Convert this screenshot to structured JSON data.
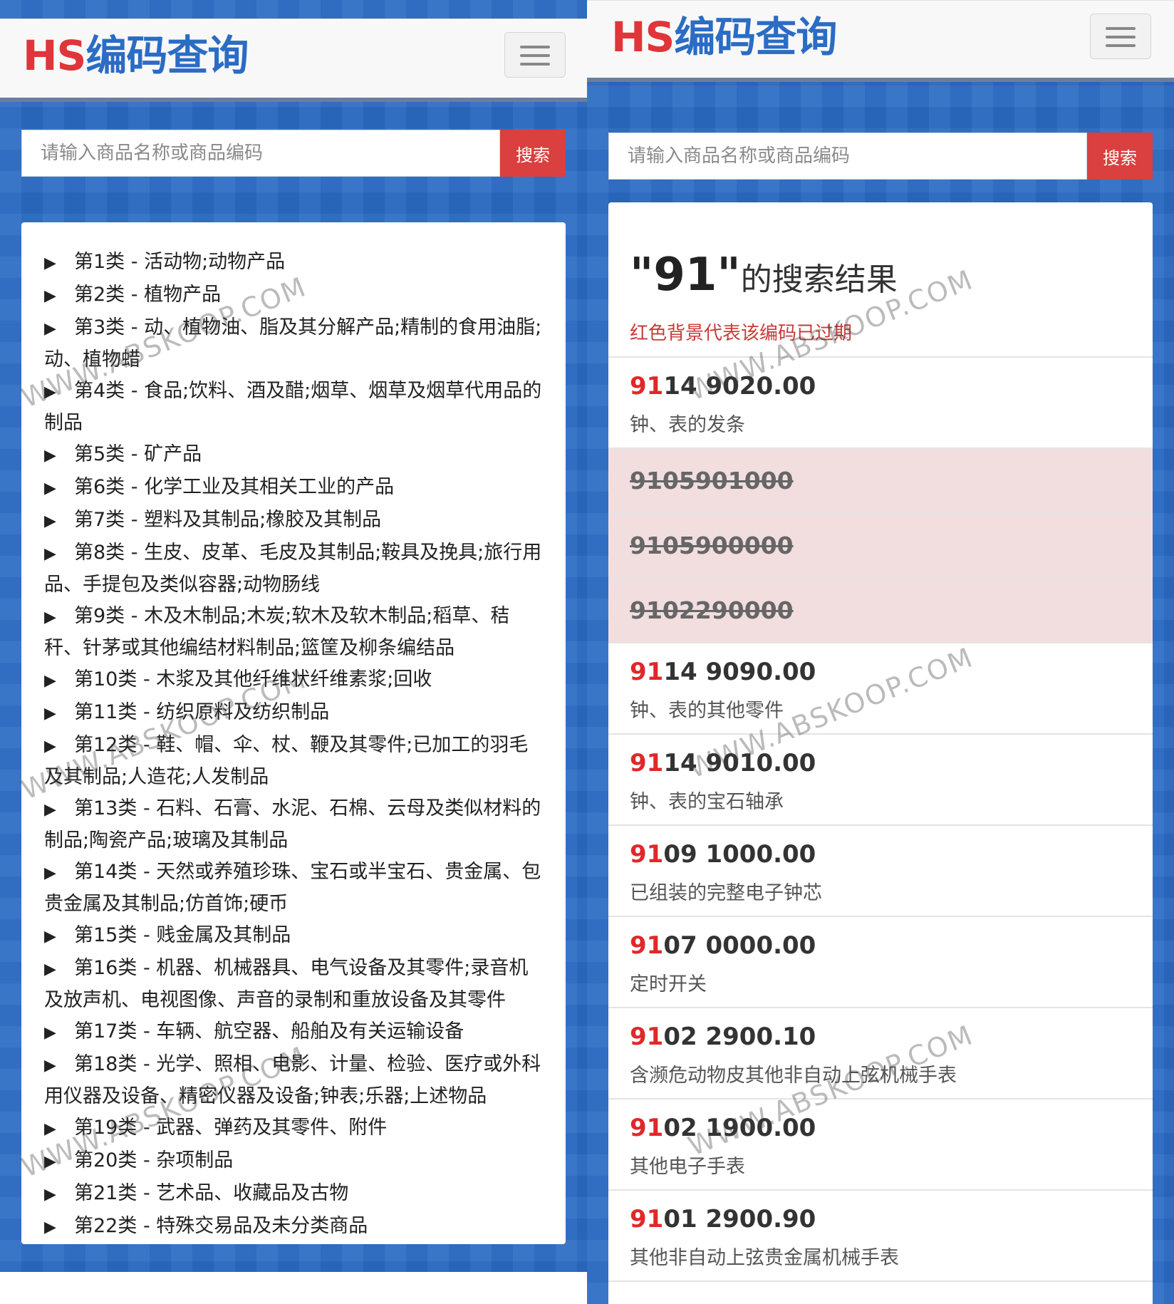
{
  "left": {
    "logo": {
      "hs": "HS",
      "cn": "编码查询"
    },
    "search": {
      "placeholder": "请输入商品名称或商品编码",
      "button": "搜索"
    },
    "categories": [
      "第1类 - 活动物;动物产品",
      "第2类 - 植物产品",
      "第3类 - 动、植物油、脂及其分解产品;精制的食用油脂;动、植物蜡",
      "第4类 - 食品;饮料、酒及醋;烟草、烟草及烟草代用品的制品",
      "第5类 - 矿产品",
      "第6类 - 化学工业及其相关工业的产品",
      "第7类 - 塑料及其制品;橡胶及其制品",
      "第8类 - 生皮、皮革、毛皮及其制品;鞍具及挽具;旅行用品、手提包及类似容器;动物肠线",
      "第9类 - 木及木制品;木炭;软木及软木制品;稻草、秸秆、针茅或其他编结材料制品;篮筐及柳条编结品",
      "第10类 - 木浆及其他纤维状纤维素浆;回收",
      "第11类 - 纺织原料及纺织制品",
      "第12类 - 鞋、帽、伞、杖、鞭及其零件;已加工的羽毛及其制品;人造花;人发制品",
      "第13类 - 石料、石膏、水泥、石棉、云母及类似材料的制品;陶瓷产品;玻璃及其制品",
      "第14类 - 天然或养殖珍珠、宝石或半宝石、贵金属、包贵金属及其制品;仿首饰;硬币",
      "第15类 - 贱金属及其制品",
      "第16类 - 机器、机械器具、电气设备及其零件;录音机及放声机、电视图像、声音的录制和重放设备及其零件",
      "第17类 - 车辆、航空器、船舶及有关运输设备",
      "第18类 - 光学、照相、电影、计量、检验、医疗或外科用仪器及设备、精密仪器及设备;钟表;乐器;上述物品",
      "第19类 - 武器、弹药及其零件、附件",
      "第20类 - 杂项制品",
      "第21类 - 艺术品、收藏品及古物",
      "第22类 - 特殊交易品及未分类商品"
    ],
    "category_marker": "▶"
  },
  "right": {
    "logo": {
      "hs": "HS",
      "cn": "编码查询"
    },
    "search": {
      "placeholder": "请输入商品名称或商品编码",
      "button": "搜索"
    },
    "results_title": {
      "query": "\"91\"",
      "suffix": "的搜索结果"
    },
    "results_note": "红色背景代表该编码已过期",
    "results": [
      {
        "prefix": "91",
        "code_rest": "14 9020.00",
        "desc": "钟、表的发条",
        "expired": false
      },
      {
        "prefix": "",
        "code_rest": "9105901000",
        "desc": "",
        "expired": true
      },
      {
        "prefix": "",
        "code_rest": "9105900000",
        "desc": "",
        "expired": true
      },
      {
        "prefix": "",
        "code_rest": "9102290000",
        "desc": "",
        "expired": true
      },
      {
        "prefix": "91",
        "code_rest": "14 9090.00",
        "desc": "钟、表的其他零件",
        "expired": false
      },
      {
        "prefix": "91",
        "code_rest": "14 9010.00",
        "desc": "钟、表的宝石轴承",
        "expired": false
      },
      {
        "prefix": "91",
        "code_rest": "09 1000.00",
        "desc": "已组装的完整电子钟芯",
        "expired": false
      },
      {
        "prefix": "91",
        "code_rest": "07 0000.00",
        "desc": "定时开关",
        "expired": false
      },
      {
        "prefix": "91",
        "code_rest": "02 2900.10",
        "desc": "含濒危动物皮其他非自动上弦机械手表",
        "expired": false
      },
      {
        "prefix": "91",
        "code_rest": "02 1900.00",
        "desc": "其他电子手表",
        "expired": false
      },
      {
        "prefix": "91",
        "code_rest": "01 2900.90",
        "desc": "其他非自动上弦贵金属机械手表",
        "expired": false
      }
    ]
  },
  "watermark": "WWW.ABSKOOP.COM",
  "colors": {
    "brand_red": "#e0353a",
    "brand_blue": "#2b6cc4",
    "search_button": "#d9403f",
    "expired_bg": "#f2dedf",
    "note_red": "#c93a36"
  }
}
